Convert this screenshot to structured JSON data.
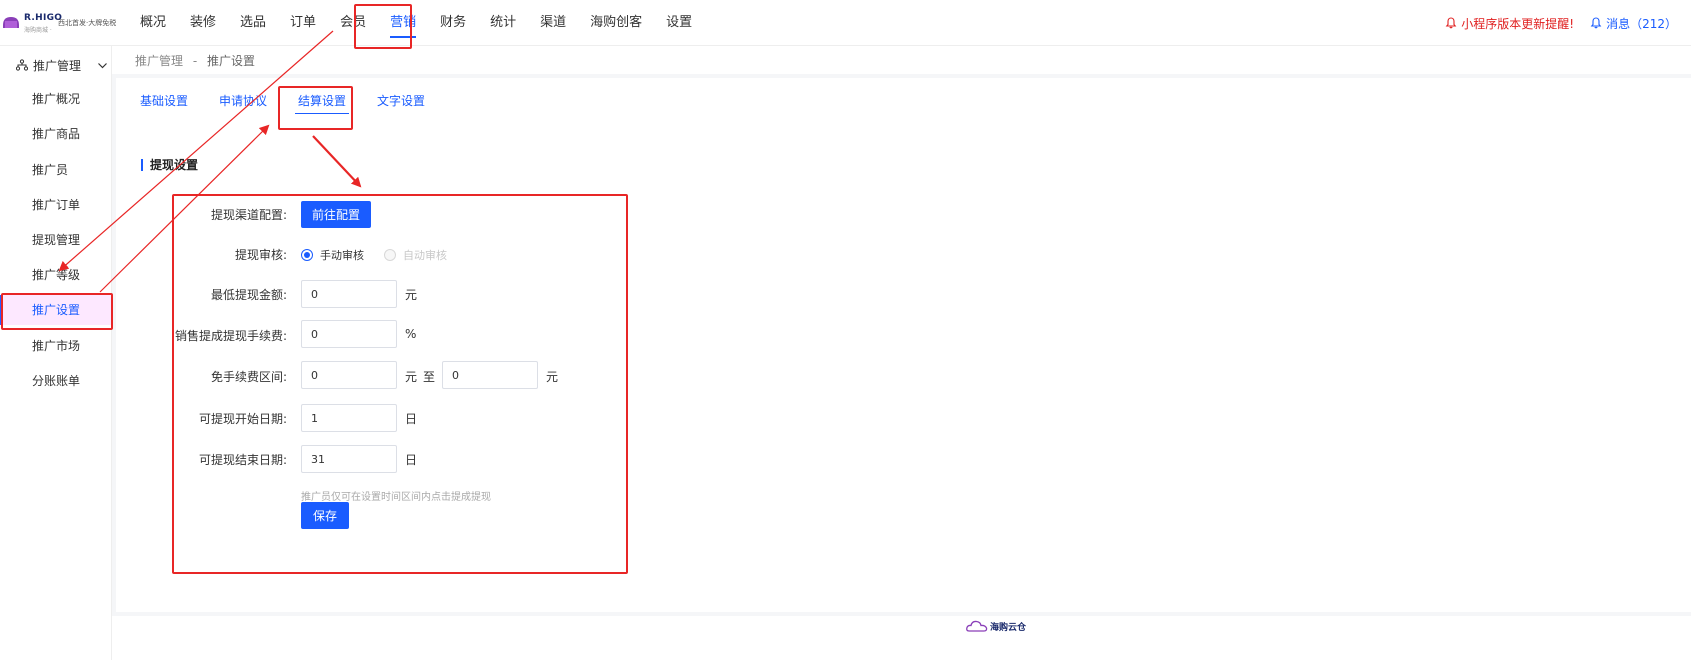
{
  "logo": {
    "brand": "R.HIGO",
    "sub": "海购商城 ·",
    "slogan": "西北首发·大牌免税"
  },
  "nav": {
    "items": [
      "概况",
      "装修",
      "选品",
      "订单",
      "会员",
      "营销",
      "财务",
      "统计",
      "渠道",
      "海购创客",
      "设置"
    ],
    "active_index": 5
  },
  "header": {
    "notice": "小程序版本更新提醒!",
    "messages": "消息（212）"
  },
  "sidebar": {
    "group_label": "推广管理",
    "items": [
      "推广概况",
      "推广商品",
      "推广员",
      "推广订单",
      "提现管理",
      "推广等级",
      "推广设置",
      "推广市场",
      "分账账单"
    ],
    "active_index": 6
  },
  "breadcrumb": {
    "parent": "推广管理",
    "sep": "-",
    "current": "推广设置"
  },
  "tabs": {
    "items": [
      "基础设置",
      "申请协议",
      "结算设置",
      "文字设置"
    ],
    "active_index": 2
  },
  "section": {
    "title": "提现设置"
  },
  "form": {
    "channel_label": "提现渠道配置:",
    "channel_button": "前往配置",
    "review_label": "提现审核:",
    "review_options": [
      "手动审核",
      "自动审核"
    ],
    "review_selected": "手动审核",
    "min_amount_label": "最低提现金额:",
    "min_amount_value": "0",
    "min_amount_unit": "元",
    "fee_label": "销售提成提现手续费:",
    "fee_value": "0",
    "fee_unit": "%",
    "free_range_label": "免手续费区间:",
    "free_range_from": "0",
    "free_range_unit": "元",
    "free_range_to_word": "至",
    "free_range_to": "0",
    "free_range_unit2": "元",
    "start_day_label": "可提现开始日期:",
    "start_day_value": "1",
    "start_day_unit": "日",
    "end_day_label": "可提现结束日期:",
    "end_day_value": "31",
    "end_day_unit": "日",
    "hint": "推广员仅可在设置时间区间内点击提成提现",
    "save_button": "保存"
  },
  "footer": {
    "brand": "海购云仓"
  },
  "colors": {
    "accent": "#1a5cff",
    "annotation": "#e82626",
    "notice": "#e02020"
  }
}
